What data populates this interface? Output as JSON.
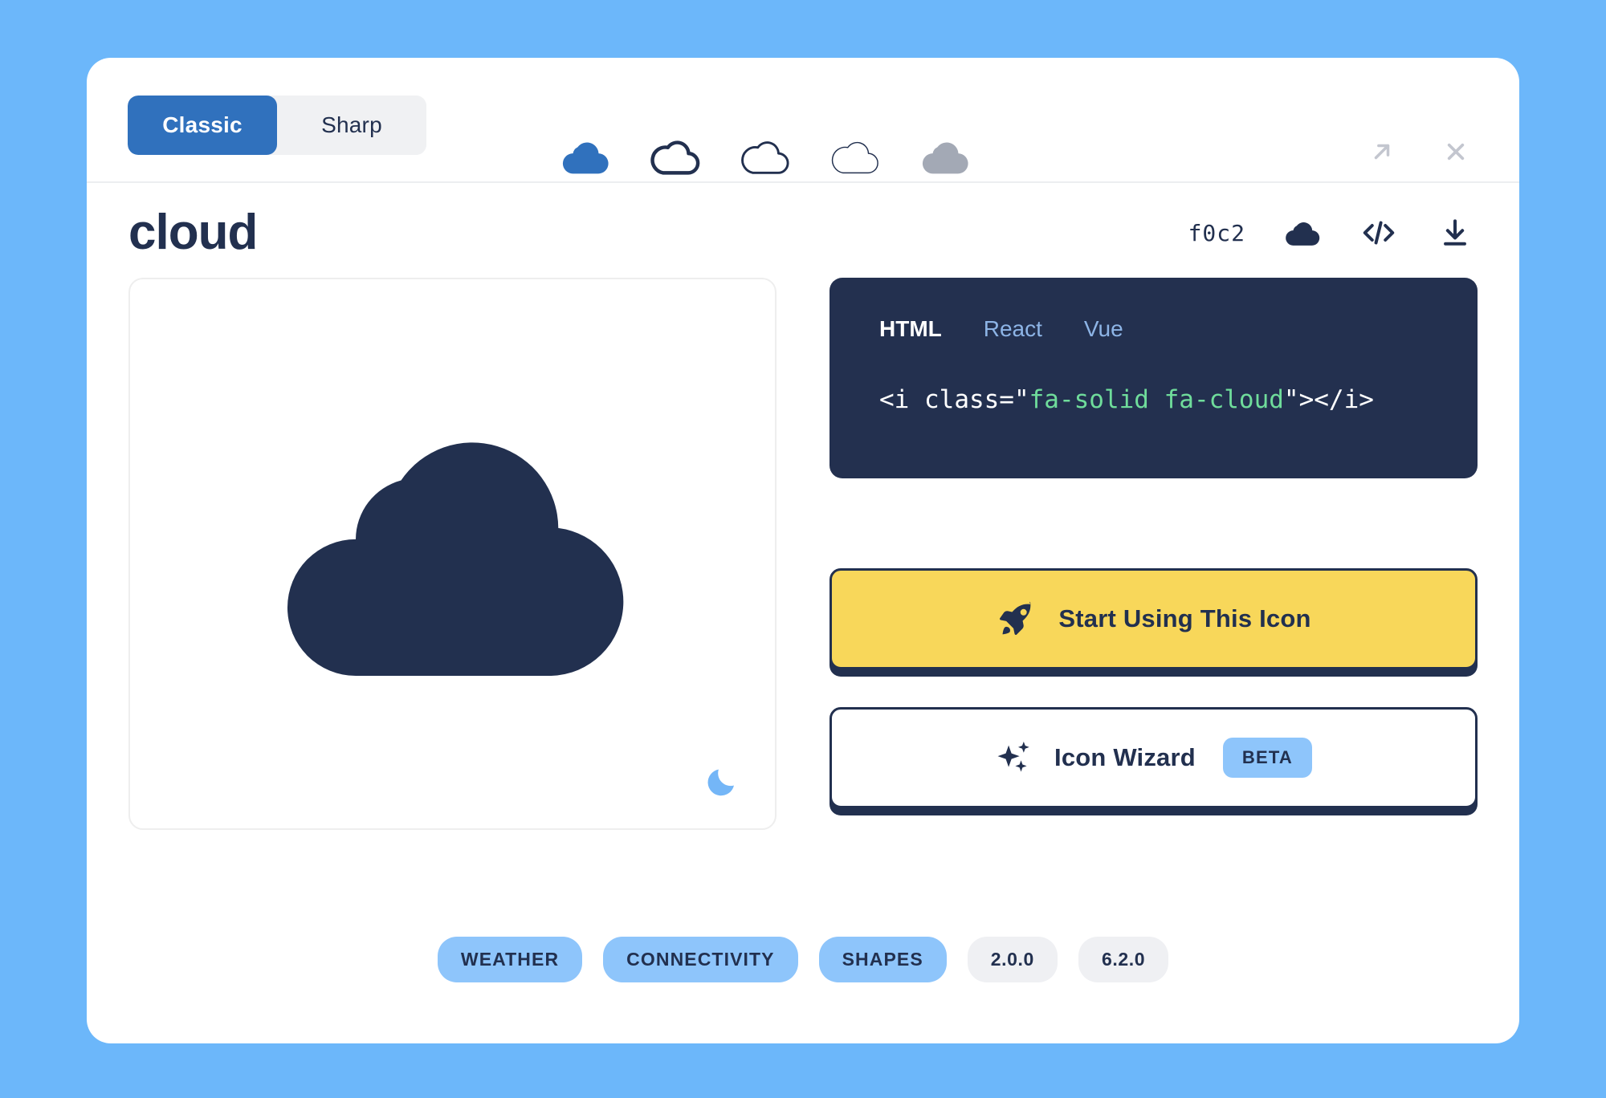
{
  "colors": {
    "page_background": "#6cb7fa",
    "card_background": "#ffffff",
    "navy": "#22304f",
    "accent_blue": "#3071bd",
    "light_blue": "#8ec5fb",
    "yellow": "#f8d75a",
    "code_background": "#23304f",
    "code_string_green": "#6fdc9b",
    "gray_pill": "#eff0f3"
  },
  "header": {
    "style_toggle": {
      "options": [
        {
          "label": "Classic",
          "active": true
        },
        {
          "label": "Sharp",
          "active": false
        }
      ]
    },
    "variants": [
      {
        "name": "cloud-solid-blue",
        "style": "solid",
        "color": "#3071bd"
      },
      {
        "name": "cloud-outline-bold",
        "style": "outline-bold",
        "color": "#22304f"
      },
      {
        "name": "cloud-outline-regular",
        "style": "outline-regular",
        "color": "#22304f"
      },
      {
        "name": "cloud-outline-thin",
        "style": "outline-thin",
        "color": "#22304f"
      },
      {
        "name": "cloud-solid-gray",
        "style": "solid",
        "color": "#a3a9b5"
      }
    ],
    "actions": [
      {
        "name": "expand-icon",
        "glyph": "arrow-up-right"
      },
      {
        "name": "close-icon",
        "glyph": "x"
      }
    ]
  },
  "title_row": {
    "icon_name": "cloud",
    "unicode": "f0c2",
    "actions": [
      {
        "name": "copy-glyph-icon",
        "glyph": "cloud"
      },
      {
        "name": "copy-code-icon",
        "glyph": "</>"
      },
      {
        "name": "download-icon",
        "glyph": "download"
      }
    ]
  },
  "preview": {
    "glyph_name": "cloud",
    "theme_toggle": "moon-icon"
  },
  "code": {
    "tabs": [
      {
        "label": "HTML",
        "active": true
      },
      {
        "label": "React",
        "active": false
      },
      {
        "label": "Vue",
        "active": false
      }
    ],
    "snippet": {
      "prefix": "<i class=\"",
      "classes": "fa-solid fa-cloud",
      "suffix": "\"></i>"
    }
  },
  "cta": {
    "primary": {
      "label": "Start Using This Icon",
      "icon": "rocket-icon"
    },
    "secondary": {
      "label": "Icon Wizard",
      "icon": "sparkles-icon",
      "badge": "BETA"
    }
  },
  "tags": {
    "categories": [
      "WEATHER",
      "CONNECTIVITY",
      "SHAPES"
    ],
    "versions": [
      "2.0.0",
      "6.2.0"
    ]
  }
}
